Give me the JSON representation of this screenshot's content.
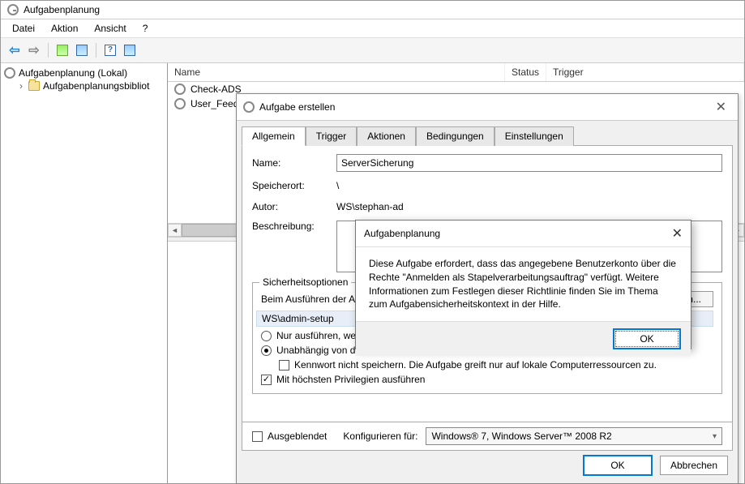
{
  "window": {
    "title": "Aufgabenplanung"
  },
  "menu": {
    "file": "Datei",
    "action": "Aktion",
    "view": "Ansicht",
    "help": "?"
  },
  "tree": {
    "root": "Aufgabenplanung (Lokal)",
    "lib": "Aufgabenplanungsbibliot"
  },
  "list": {
    "headers": {
      "name": "Name",
      "status": "Status",
      "trigger": "Trigger"
    },
    "rows": [
      {
        "name": "Check-ADS"
      },
      {
        "name": "User_Feed_S"
      }
    ]
  },
  "dlg": {
    "title": "Aufgabe erstellen",
    "tabs": {
      "general": "Allgemein",
      "trigger": "Trigger",
      "actions": "Aktionen",
      "conditions": "Bedingungen",
      "settings": "Einstellungen"
    },
    "labels": {
      "name": "Name:",
      "location": "Speicherort:",
      "author": "Autor:",
      "description": "Beschreibung:"
    },
    "values": {
      "name": "ServerSicherung",
      "location": "\\",
      "author": "WS\\stephan-ad",
      "useracct": "WS\\admin-setup"
    },
    "security": {
      "group_title": "Sicherheitsoptionen",
      "run_as_line": "Beim Ausführen der Au",
      "change_user": "ern...",
      "only_logged_on": "Nur ausführen, wenn",
      "independent": "Unabhängig von der Benutzeranmeldung ausführen",
      "no_password": "Kennwort nicht speichern. Die Aufgabe greift nur auf lokale Computerressourcen zu.",
      "highest_priv": "Mit höchsten Privilegien ausführen"
    },
    "bottom": {
      "hidden": "Ausgeblendet",
      "configure_for": "Konfigurieren für:",
      "combo_value": "Windows® 7, Windows Server™ 2008 R2"
    },
    "buttons": {
      "ok": "OK",
      "cancel": "Abbrechen"
    }
  },
  "msg": {
    "title": "Aufgabenplanung",
    "body": "Diese Aufgabe erfordert, dass das angegebene Benutzerkonto über die Rechte \"Anmelden als Stapelverarbeitungsauftrag\" verfügt. Weitere Informationen zum Festlegen dieser Richtlinie finden Sie im Thema zum Aufgabensicherheitskontext in der Hilfe.",
    "ok": "OK"
  }
}
